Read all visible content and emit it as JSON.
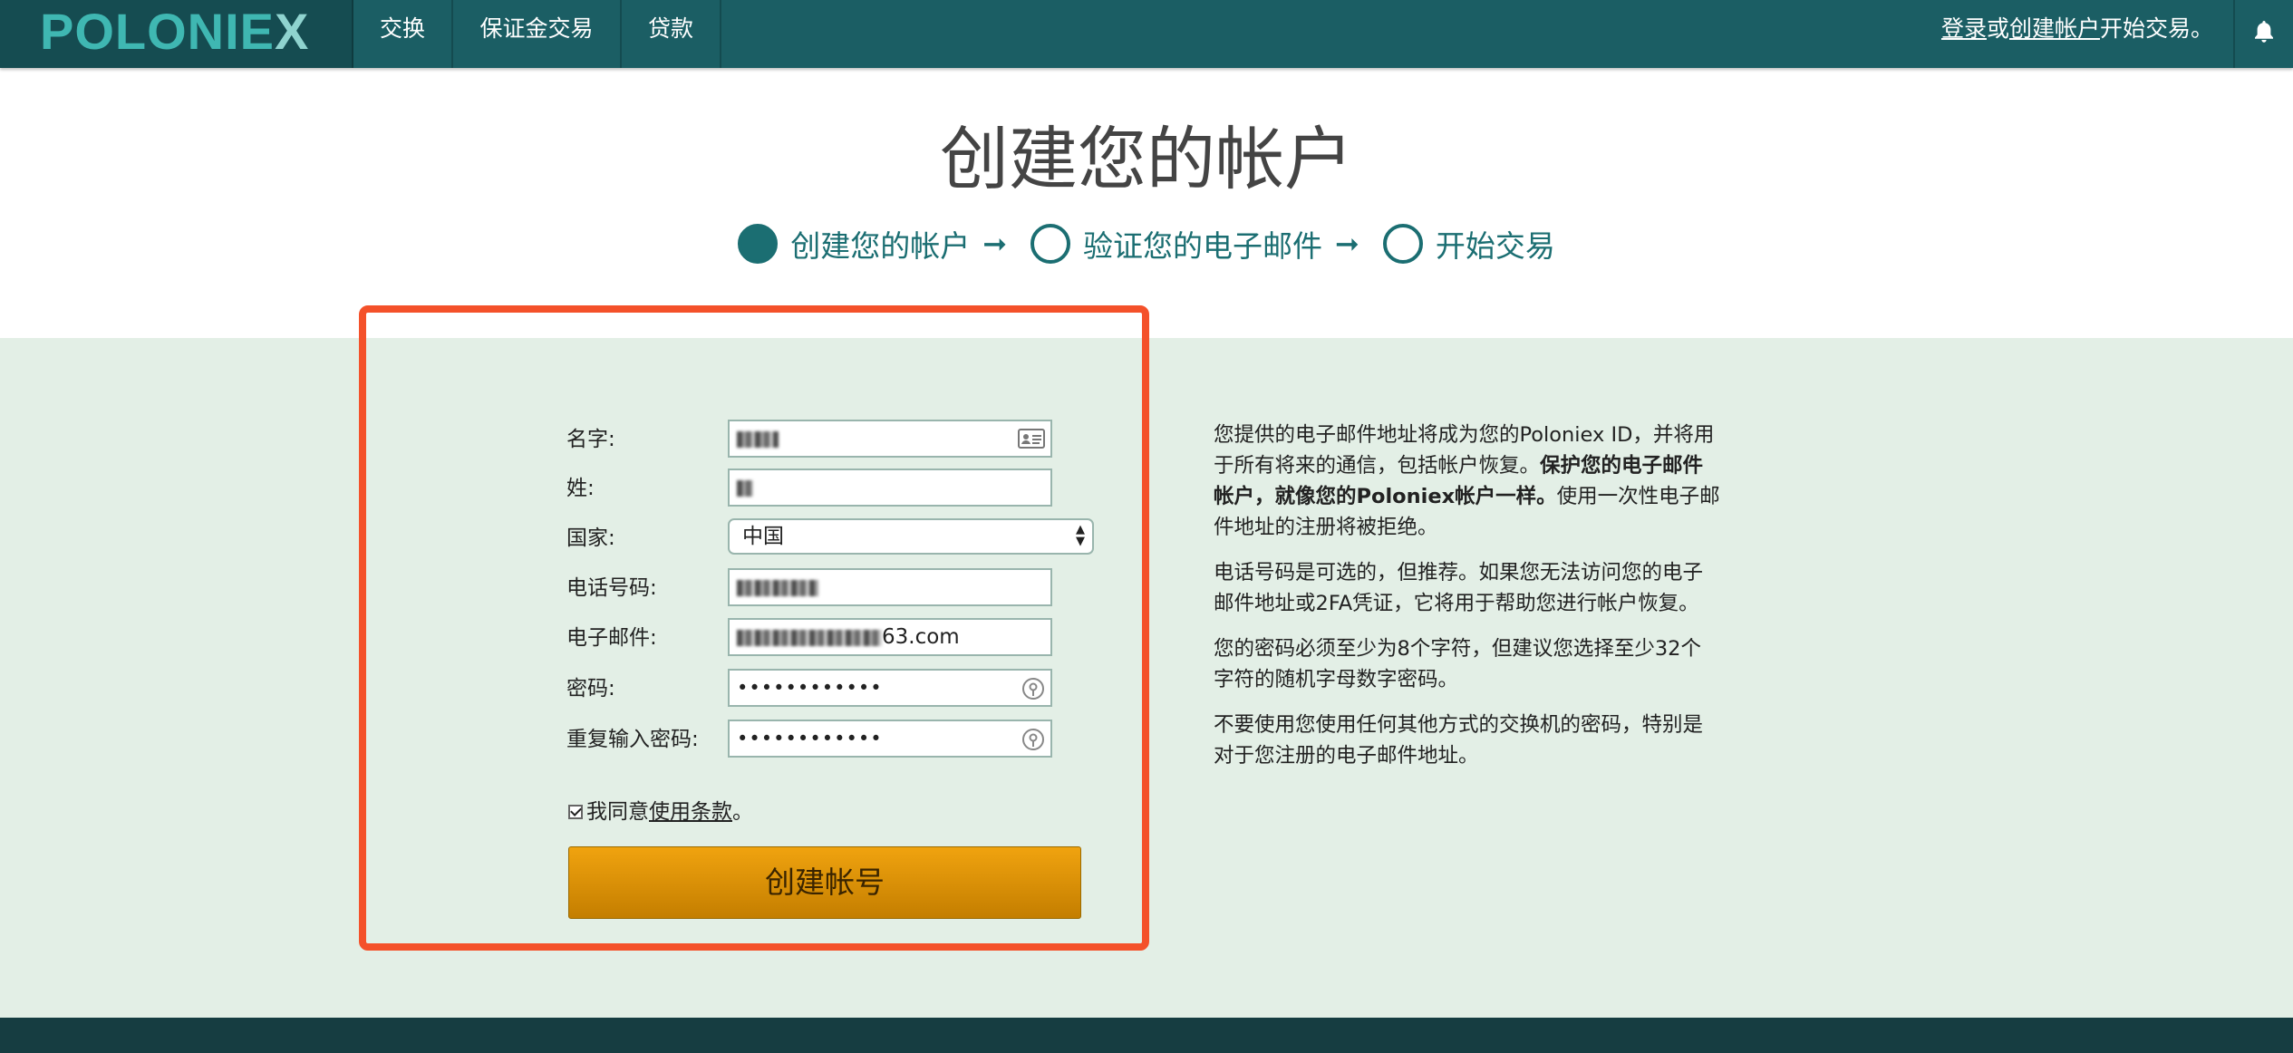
{
  "nav": {
    "logo_main": "POLONIE",
    "logo_x": "X",
    "items": [
      "交换",
      "保证金交易",
      "贷款"
    ],
    "login_link": "登录",
    "or_text": "或",
    "signup_link": "创建帐户",
    "tail_text": "开始交易。"
  },
  "page": {
    "title": "创建您的帐户",
    "steps": [
      "创建您的帐户",
      "验证您的电子邮件",
      "开始交易"
    ],
    "step_arrow": "➞"
  },
  "form": {
    "first_name_label": "名字:",
    "last_name_label": "姓:",
    "country_label": "国家:",
    "country_value": "中国",
    "phone_label": "电话号码:",
    "email_label": "电子邮件:",
    "email_suffix_visible": "63.com",
    "password_label": "密码:",
    "password_value": "••••••••••••",
    "repeat_password_label": "重复输入密码:",
    "repeat_password_value": "••••••••••••",
    "agree_text": "我同意",
    "terms_link": "使用条款",
    "agree_tail": "。",
    "submit_label": "创建帐号"
  },
  "info": {
    "p1_a": "您提供的电子邮件地址将成为您的Poloniex ID，并将用于所有将来的通信，包括帐户恢复。",
    "p1_b": "保护您的电子邮件帐户，就像您的Poloniex帐户一样。",
    "p1_c": "使用一次性电子邮件地址的注册将被拒绝。",
    "p2": "电话号码是可选的，但推荐。如果您无法访问您的电子邮件地址或2FA凭证，它将用于帮助您进行帐户恢复。",
    "p3": "您的密码必须至少为8个字符，但建议您选择至少32个字符的随机字母数字密码。",
    "p4": "不要使用您使用任何其他方式的交换机的密码，特别是对于您注册的电子邮件地址。"
  },
  "colors": {
    "nav_bg": "#1b5e64",
    "accent_teal": "#1b6e72",
    "panel_bg": "#e3efe6",
    "button_orange": "#e0940a",
    "highlight_red": "#f4512a"
  },
  "icons": [
    "bell-icon",
    "contact-card-icon",
    "password-key-icon"
  ]
}
